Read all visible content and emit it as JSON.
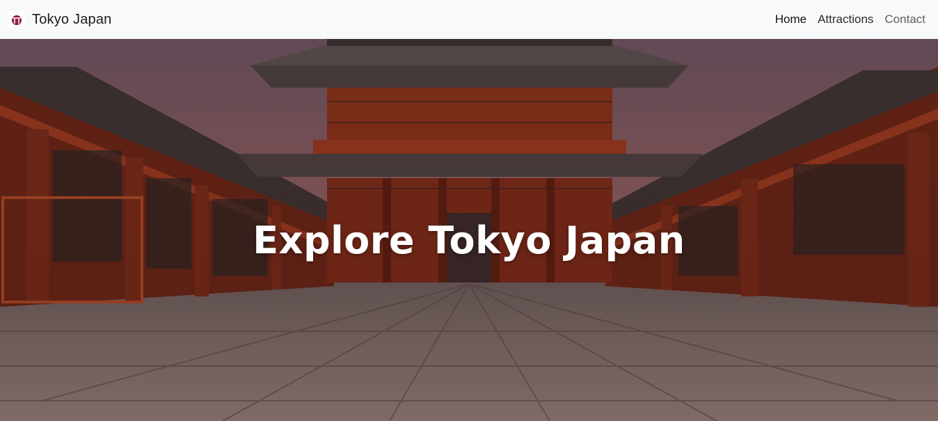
{
  "navbar": {
    "brand_text": "Tokyo Japan",
    "logo_icon": "torii-gate-icon",
    "links": [
      {
        "label": "Home",
        "state": "active"
      },
      {
        "label": "Attractions",
        "state": "normal"
      },
      {
        "label": "Contact",
        "state": "muted"
      }
    ]
  },
  "hero": {
    "title": "Explore Tokyo Japan",
    "background": "temple-gate-photo",
    "colors": {
      "sky_top": "#6d5566",
      "sky_bottom": "#b0685c",
      "temple_red": "#7f2a17",
      "roof": "#3f3a3a",
      "pavement": "#8a7a76",
      "overlay": "#2a1410"
    }
  }
}
